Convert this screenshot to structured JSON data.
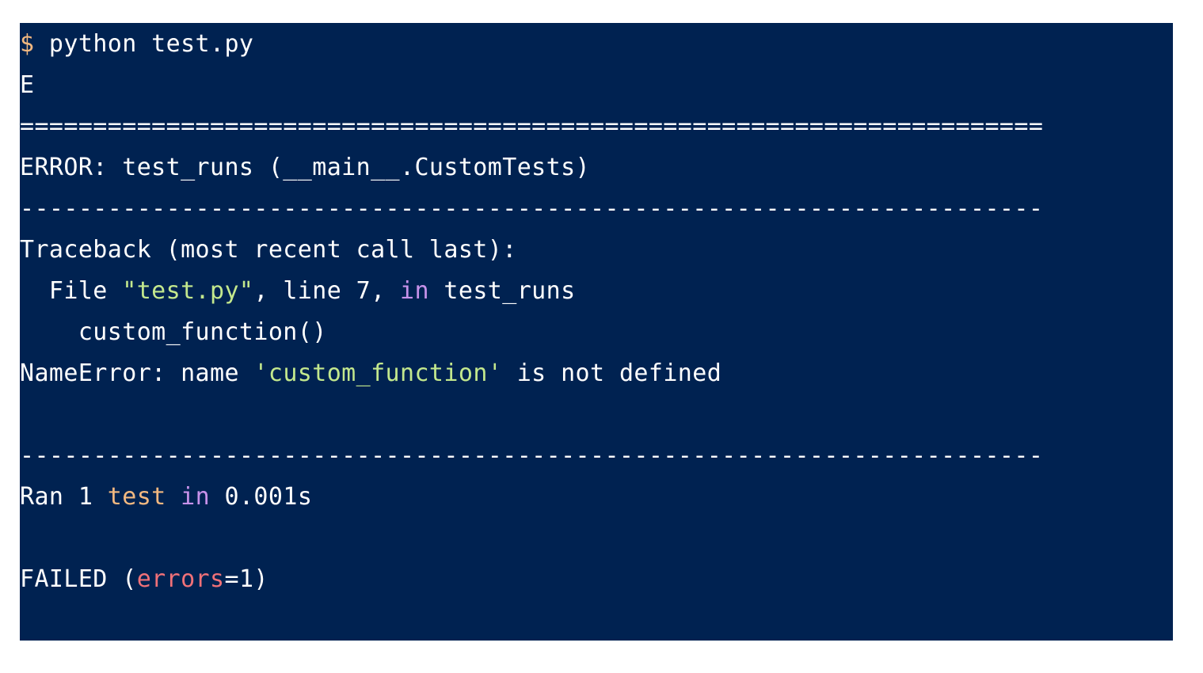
{
  "colors": {
    "background": "#002251",
    "text": "#ffffff",
    "prompt": "#f2b880",
    "string": "#c3e88d",
    "keyword": "#c792ea",
    "builtin": "#f2b880",
    "param": "#f07178"
  },
  "lines": {
    "cmd_prompt": "$",
    "cmd_text": " python test.py",
    "status": "E",
    "separator_eq": "======================================================================",
    "error_header": "ERROR: test_runs (__main__.CustomTests)",
    "separator_dash_1": "----------------------------------------------------------------------",
    "traceback_header": "Traceback (most recent call last):",
    "file_prefix": "  File ",
    "file_name": "\"test.py\"",
    "file_mid": ", line 7, ",
    "file_in": "in",
    "file_suffix": " test_runs",
    "code_line": "    custom_function()",
    "error_prefix": "NameError: name ",
    "error_name": "'custom_function'",
    "error_suffix": " is not defined",
    "separator_dash_2": "----------------------------------------------------------------------",
    "ran_prefix": "Ran 1 ",
    "ran_test": "test",
    "ran_space": " ",
    "ran_in": "in",
    "ran_suffix": " 0.001s",
    "failed_prefix": "FAILED (",
    "failed_param": "errors",
    "failed_suffix": "=1)"
  }
}
